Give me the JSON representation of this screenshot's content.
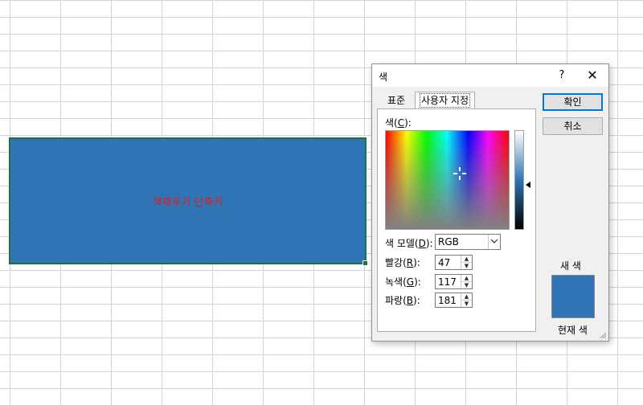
{
  "sheet": {
    "cell_text": "색채우기 단축키",
    "fill_color": "#2f75b5",
    "text_color": "#e8181b"
  },
  "dialog": {
    "title": "색",
    "help": "?",
    "close": "✕",
    "tabs": {
      "standard": "표준",
      "custom": "사용자 지정"
    },
    "color_label": {
      "text": "색(",
      "key": "C",
      "end": "):"
    },
    "model": {
      "text": "색 모델(",
      "key": "D",
      "end": "):",
      "value": "RGB"
    },
    "red": {
      "text": "빨강(",
      "key": "R",
      "end": "):",
      "value": "47"
    },
    "green": {
      "text": "녹색(",
      "key": "G",
      "end": "):",
      "value": "117"
    },
    "blue": {
      "text": "파랑(",
      "key": "B",
      "end": "):",
      "value": "181"
    },
    "ok": "확인",
    "cancel": "취소",
    "new_label": "새 색",
    "current_label": "현재 색",
    "current_color": "#2f75b5"
  }
}
